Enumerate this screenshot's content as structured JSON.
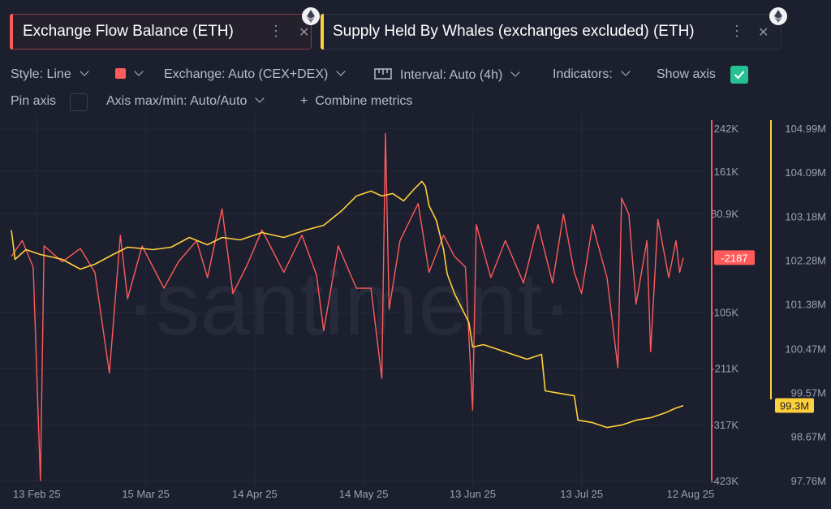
{
  "metrics": [
    {
      "title": "Exchange Flow Balance (ETH)",
      "color": "#ff5b5b",
      "icon": "ethereum-icon"
    },
    {
      "title": "Supply Held By Whales (exchanges excluded) (ETH)",
      "color": "#ffd03b",
      "icon": "ethereum-icon"
    }
  ],
  "controls": {
    "style": "Style: Line",
    "exchange": "Exchange: Auto (CEX+DEX)",
    "interval": "Interval: Auto (4h)",
    "indicators": "Indicators:",
    "show_axis": "Show axis",
    "show_axis_checked": true,
    "pin_axis": "Pin axis",
    "pin_axis_checked": false,
    "axis_maxmin": "Axis max/min: Auto/Auto",
    "combine": "Combine metrics"
  },
  "chart_data": {
    "type": "line",
    "watermark": "·santiment·",
    "x_labels": [
      "13 Feb 25",
      "15 Mar 25",
      "14 Apr 25",
      "14 May 25",
      "13 Jun 25",
      "13 Jul 25",
      "12 Aug 25"
    ],
    "series": [
      {
        "name": "Exchange Flow Balance (ETH)",
        "color": "#ff5b5b",
        "axis_ticks": [
          "242K",
          "161K",
          "80.9K",
          "-105K",
          "-211K",
          "-317K",
          "-423K"
        ],
        "ylim": [
          -423000,
          242000
        ],
        "last_value_label": "-2187",
        "last_value": -2187,
        "points": [
          [
            "2025-02-06",
            0
          ],
          [
            "2025-02-09",
            30000
          ],
          [
            "2025-02-12",
            -20000
          ],
          [
            "2025-02-14",
            -423000
          ],
          [
            "2025-02-15",
            20000
          ],
          [
            "2025-02-20",
            -10000
          ],
          [
            "2025-02-25",
            15000
          ],
          [
            "2025-03-01",
            -30000
          ],
          [
            "2025-03-05",
            -220000
          ],
          [
            "2025-03-08",
            40000
          ],
          [
            "2025-03-10",
            -80000
          ],
          [
            "2025-03-14",
            20000
          ],
          [
            "2025-03-20",
            -60000
          ],
          [
            "2025-03-24",
            -10000
          ],
          [
            "2025-03-29",
            30000
          ],
          [
            "2025-04-01",
            -40000
          ],
          [
            "2025-04-05",
            90000
          ],
          [
            "2025-04-08",
            -70000
          ],
          [
            "2025-04-12",
            -15000
          ],
          [
            "2025-04-16",
            50000
          ],
          [
            "2025-04-22",
            -30000
          ],
          [
            "2025-04-27",
            40000
          ],
          [
            "2025-05-01",
            -35000
          ],
          [
            "2025-05-03",
            -140000
          ],
          [
            "2025-05-07",
            20000
          ],
          [
            "2025-05-12",
            -60000
          ],
          [
            "2025-05-16",
            -60000
          ],
          [
            "2025-05-19",
            -230000
          ],
          [
            "2025-05-20",
            232000
          ],
          [
            "2025-05-21",
            -100000
          ],
          [
            "2025-05-24",
            30000
          ],
          [
            "2025-05-29",
            100000
          ],
          [
            "2025-06-01",
            -30000
          ],
          [
            "2025-06-05",
            40000
          ],
          [
            "2025-06-08",
            0
          ],
          [
            "2025-06-11",
            -20000
          ],
          [
            "2025-06-13",
            -290000
          ],
          [
            "2025-06-14",
            60000
          ],
          [
            "2025-06-18",
            -40000
          ],
          [
            "2025-06-22",
            30000
          ],
          [
            "2025-06-27",
            -50000
          ],
          [
            "2025-07-01",
            60000
          ],
          [
            "2025-07-05",
            -50000
          ],
          [
            "2025-07-08",
            80000
          ],
          [
            "2025-07-11",
            -30000
          ],
          [
            "2025-07-13",
            -70000
          ],
          [
            "2025-07-16",
            60000
          ],
          [
            "2025-07-20",
            -40000
          ],
          [
            "2025-07-23",
            -210000
          ],
          [
            "2025-07-24",
            110000
          ],
          [
            "2025-07-26",
            80000
          ],
          [
            "2025-07-28",
            -90000
          ],
          [
            "2025-07-31",
            30000
          ],
          [
            "2025-08-01",
            -180000
          ],
          [
            "2025-08-03",
            70000
          ],
          [
            "2025-08-06",
            -40000
          ],
          [
            "2025-08-08",
            30000
          ],
          [
            "2025-08-09",
            -30000
          ],
          [
            "2025-08-10",
            -2187
          ]
        ]
      },
      {
        "name": "Supply Held By Whales (exchanges excluded) (ETH)",
        "color": "#ffd03b",
        "axis_ticks": [
          "104.99M",
          "104.09M",
          "103.18M",
          "102.28M",
          "101.38M",
          "100.47M",
          "99.57M",
          "98.67M",
          "97.76M"
        ],
        "ylim": [
          97.76,
          104.99
        ],
        "unit": "M",
        "last_value_label": "99.3M",
        "last_value": 99.3,
        "points": [
          [
            "2025-02-06",
            102.9
          ],
          [
            "2025-02-07",
            102.3
          ],
          [
            "2025-02-10",
            102.5
          ],
          [
            "2025-02-14",
            102.4
          ],
          [
            "2025-02-20",
            102.3
          ],
          [
            "2025-02-25",
            102.1
          ],
          [
            "2025-03-01",
            102.2
          ],
          [
            "2025-03-06",
            102.4
          ],
          [
            "2025-03-10",
            102.55
          ],
          [
            "2025-03-17",
            102.5
          ],
          [
            "2025-03-22",
            102.55
          ],
          [
            "2025-03-27",
            102.75
          ],
          [
            "2025-04-01",
            102.6
          ],
          [
            "2025-04-05",
            102.75
          ],
          [
            "2025-04-10",
            102.7
          ],
          [
            "2025-04-16",
            102.85
          ],
          [
            "2025-04-22",
            102.75
          ],
          [
            "2025-04-28",
            102.9
          ],
          [
            "2025-05-03",
            103.0
          ],
          [
            "2025-05-08",
            103.3
          ],
          [
            "2025-05-12",
            103.6
          ],
          [
            "2025-05-16",
            103.7
          ],
          [
            "2025-05-19",
            103.6
          ],
          [
            "2025-05-22",
            103.65
          ],
          [
            "2025-05-25",
            103.5
          ],
          [
            "2025-05-28",
            103.75
          ],
          [
            "2025-05-30",
            103.9
          ],
          [
            "2025-05-31",
            103.8
          ],
          [
            "2025-06-01",
            103.4
          ],
          [
            "2025-06-03",
            103.1
          ],
          [
            "2025-06-05",
            102.5
          ],
          [
            "2025-06-06",
            102.0
          ],
          [
            "2025-06-08",
            101.6
          ],
          [
            "2025-06-10",
            101.3
          ],
          [
            "2025-06-12",
            101.0
          ],
          [
            "2025-06-13",
            100.5
          ],
          [
            "2025-06-16",
            100.55
          ],
          [
            "2025-06-20",
            100.45
          ],
          [
            "2025-06-24",
            100.35
          ],
          [
            "2025-06-28",
            100.25
          ],
          [
            "2025-07-02",
            100.35
          ],
          [
            "2025-07-03",
            99.6
          ],
          [
            "2025-07-07",
            99.55
          ],
          [
            "2025-07-11",
            99.5
          ],
          [
            "2025-07-12",
            99.0
          ],
          [
            "2025-07-16",
            98.95
          ],
          [
            "2025-07-20",
            98.85
          ],
          [
            "2025-07-24",
            98.9
          ],
          [
            "2025-07-28",
            99.0
          ],
          [
            "2025-08-01",
            99.05
          ],
          [
            "2025-08-05",
            99.15
          ],
          [
            "2025-08-08",
            99.25
          ],
          [
            "2025-08-10",
            99.3
          ]
        ]
      }
    ]
  }
}
